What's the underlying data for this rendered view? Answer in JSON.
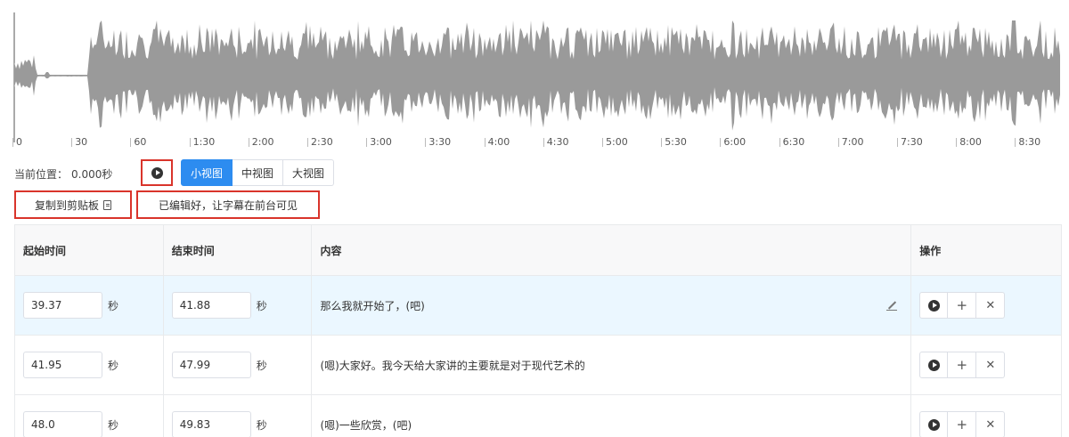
{
  "waveform": {
    "color": "#9a9a9a",
    "tick_labels": [
      "0",
      "30",
      "60",
      "1:30",
      "2:00",
      "2:30",
      "3:00",
      "3:30",
      "4:00",
      "4:30",
      "5:00",
      "5:30",
      "6:00",
      "6:30",
      "7:00",
      "7:30",
      "8:00",
      "8:30"
    ]
  },
  "controls": {
    "position_label": "当前位置：",
    "position_value": "0.000秒",
    "views": [
      {
        "label": "小视图",
        "active": true
      },
      {
        "label": "中视图",
        "active": false
      },
      {
        "label": "大视图",
        "active": false
      }
    ]
  },
  "actions": {
    "copy_label": "复制到剪贴板",
    "publish_label": "已编辑好，让字幕在前台可见"
  },
  "table": {
    "headers": [
      "起始时间",
      "结束时间",
      "内容",
      "操作"
    ],
    "unit": "秒",
    "rows": [
      {
        "start": "39.37",
        "end": "41.88",
        "content": "那么我就开始了，(吧)",
        "highlight": true
      },
      {
        "start": "41.95",
        "end": "47.99",
        "content": "(嗯)大家好。我今天给大家讲的主要就是对于现代艺术的",
        "highlight": false
      },
      {
        "start": "48.0",
        "end": "49.83",
        "content": "(嗯)一些欣赏，(吧)",
        "highlight": false
      }
    ],
    "op_icons": [
      "play-icon",
      "plus-icon",
      "close-icon"
    ]
  },
  "colors": {
    "accent": "#2d8cf0",
    "annotation_red": "#d9342b",
    "row_highlight": "#ebf7ff"
  }
}
